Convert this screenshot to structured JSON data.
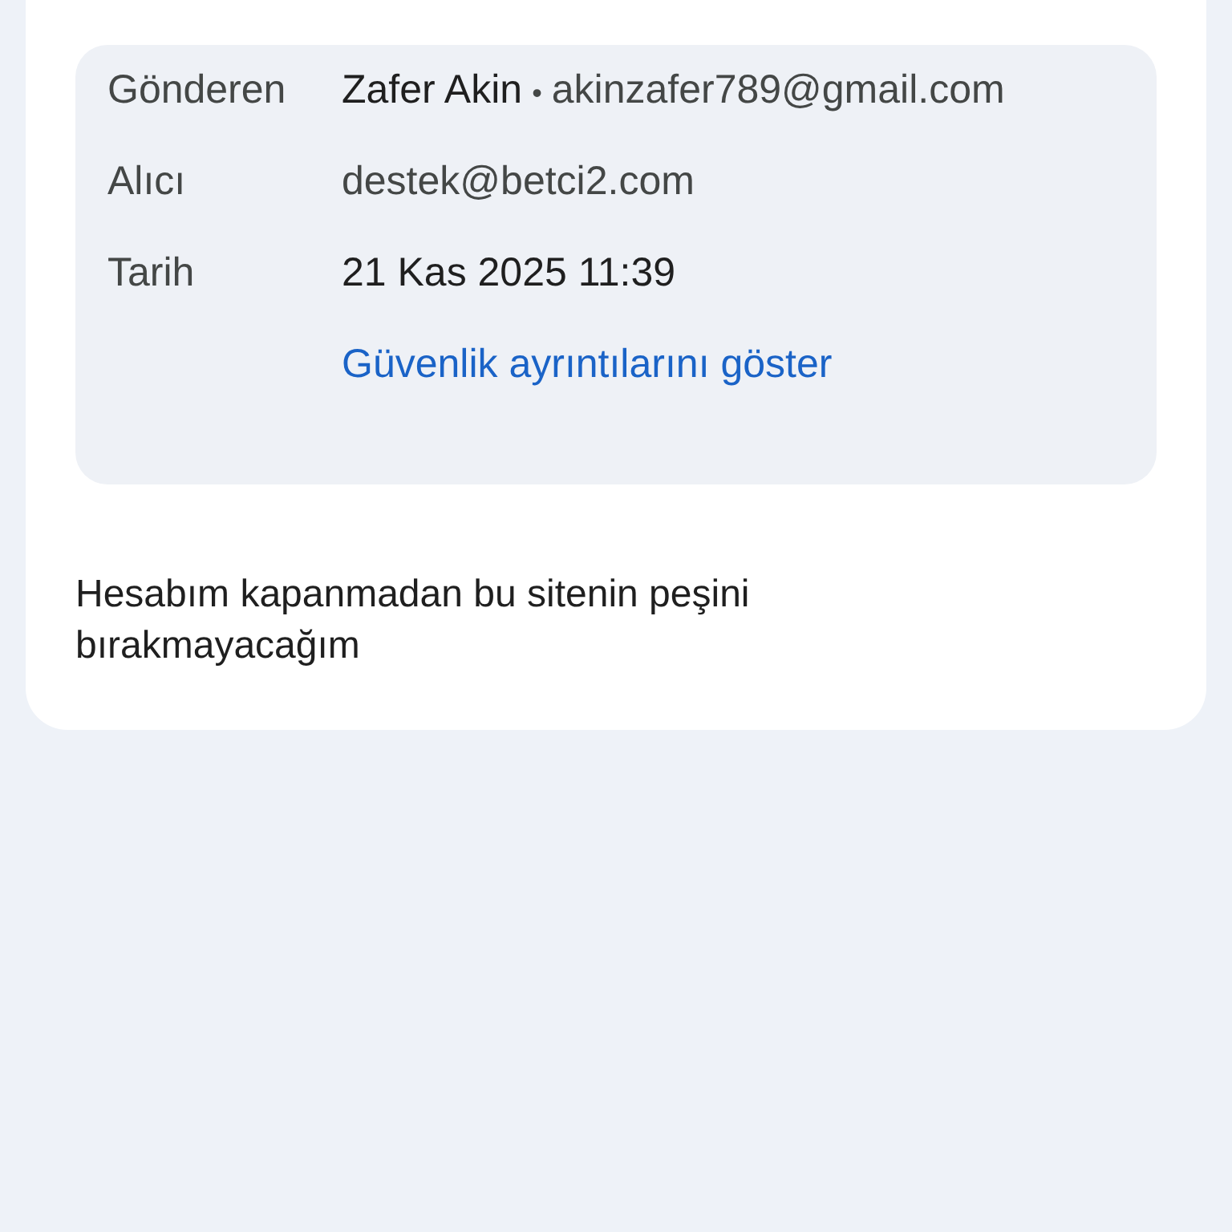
{
  "details": {
    "rows": [
      {
        "kind": "sender",
        "label": "Gönderen",
        "name": "Zafer Akin",
        "separator": "•",
        "value": "akinzafer789@gmail.com"
      },
      {
        "kind": "address",
        "label": "Alıcı",
        "value": "destek@betci2.com"
      },
      {
        "kind": "date",
        "label": "Tarih",
        "value": "21 Kas 2025 11:39"
      }
    ],
    "link": "Güvenlik ayrıntılarını göster"
  },
  "message": {
    "text": "Hesabım kapanmadan bu sitenin peşini bırakmayacağım"
  }
}
